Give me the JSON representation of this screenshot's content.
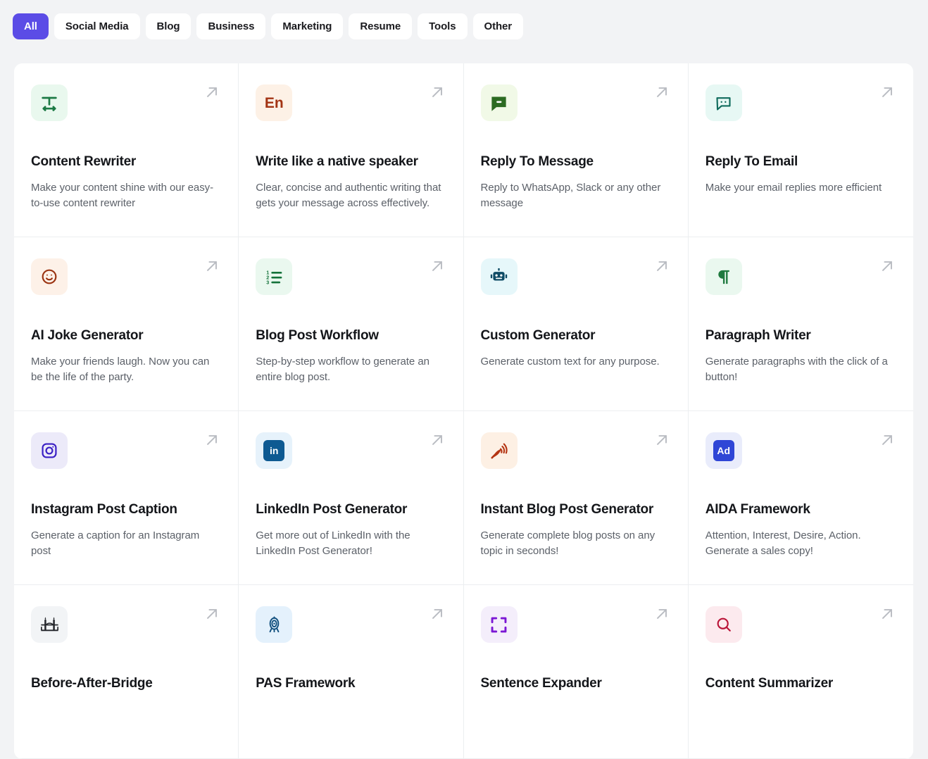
{
  "tabs": [
    {
      "label": "All",
      "active": true
    },
    {
      "label": "Social Media",
      "active": false
    },
    {
      "label": "Blog",
      "active": false
    },
    {
      "label": "Business",
      "active": false
    },
    {
      "label": "Marketing",
      "active": false
    },
    {
      "label": "Resume",
      "active": false
    },
    {
      "label": "Tools",
      "active": false
    },
    {
      "label": "Other",
      "active": false
    }
  ],
  "colors": {
    "page_background": "#f2f3f5",
    "active_tab_background": "#5b4ce6",
    "active_tab_text": "#ffffff",
    "tab_background": "#ffffff",
    "tab_text": "#1a1a1e",
    "card_background": "#ffffff",
    "card_divider": "#eceef0",
    "title_text": "#14161a",
    "description_text": "#5c6169",
    "arrow_icon": "#b9bcc2"
  },
  "cards": [
    {
      "title": "Content Rewriter",
      "description": "Make your content shine with our easy-to-use content rewriter",
      "icon": "text-resize-icon",
      "icon_color": "#1d7a45",
      "icon_background": "#e9f8ee",
      "open_icon": "arrow-up-right-icon"
    },
    {
      "title": "Write like a native speaker",
      "description": "Clear, concise and authentic writing that gets your message across effectively.",
      "icon": "en-language-icon",
      "icon_label": "En",
      "icon_color": "#a33414",
      "icon_background": "#fdf1e6",
      "open_icon": "arrow-up-right-icon"
    },
    {
      "title": "Reply To Message",
      "description": "Reply to WhatsApp, Slack or any other message",
      "icon": "chat-bubble-filled-icon",
      "icon_color": "#2c6b22",
      "icon_background": "#f1f9e7",
      "open_icon": "arrow-up-right-icon"
    },
    {
      "title": "Reply To Email",
      "description": "Make your email replies more efficient",
      "icon": "chat-bubble-dots-icon",
      "icon_color": "#0f6b5c",
      "icon_background": "#e7f8f4",
      "open_icon": "arrow-up-right-icon"
    },
    {
      "title": "AI Joke Generator",
      "description": "Make your friends laugh. Now you can be the life of the party.",
      "icon": "smiley-face-icon",
      "icon_color": "#9b3412",
      "icon_background": "#fdf1e8",
      "open_icon": "arrow-up-right-icon"
    },
    {
      "title": "Blog Post Workflow",
      "description": "Step-by-step workflow to generate an entire blog post.",
      "icon": "numbered-list-icon",
      "icon_color": "#14723a",
      "icon_background": "#eaf8ef",
      "open_icon": "arrow-up-right-icon"
    },
    {
      "title": "Custom Generator",
      "description": "Generate custom text for any purpose.",
      "icon": "robot-icon",
      "icon_color": "#0f4c66",
      "icon_background": "#e6f7fa",
      "open_icon": "arrow-up-right-icon"
    },
    {
      "title": "Paragraph Writer",
      "description": "Generate paragraphs with the click of a button!",
      "icon": "pilcrow-icon",
      "icon_color": "#1f7a3f",
      "icon_background": "#eaf8ef",
      "open_icon": "arrow-up-right-icon"
    },
    {
      "title": "Instagram Post Caption",
      "description": "Generate a caption for an Instagram post",
      "icon": "instagram-icon",
      "icon_color": "#3a1fc4",
      "icon_background": "#eceaf9",
      "open_icon": "arrow-up-right-icon"
    },
    {
      "title": "LinkedIn Post Generator",
      "description": "Get more out of LinkedIn with the LinkedIn Post Generator!",
      "icon": "linkedin-icon",
      "icon_label": "in",
      "icon_color": "#0e5a92",
      "icon_background": "#e6f2fb",
      "open_icon": "arrow-up-right-icon"
    },
    {
      "title": "Instant Blog Post Generator",
      "description": "Generate complete blog posts on any topic in seconds!",
      "icon": "quill-signal-icon",
      "icon_color": "#b43412",
      "icon_background": "#fdf0e4",
      "open_icon": "arrow-up-right-icon"
    },
    {
      "title": "AIDA Framework",
      "description": "Attention, Interest, Desire, Action. Generate a sales copy!",
      "icon": "ad-badge-icon",
      "icon_label": "Ad",
      "icon_color": "#2f46d6",
      "icon_background": "#e9ecfb",
      "open_icon": "arrow-up-right-icon"
    },
    {
      "title": "Before-After-Bridge",
      "description": "",
      "icon": "bridge-icon",
      "icon_color": "#24262b",
      "icon_background": "#f2f4f6",
      "open_icon": "arrow-up-right-icon"
    },
    {
      "title": "PAS Framework",
      "description": "",
      "icon": "target-icon",
      "icon_color": "#11507f",
      "icon_background": "#e4f1fc",
      "open_icon": "arrow-up-right-icon"
    },
    {
      "title": "Sentence Expander",
      "description": "",
      "icon": "expand-corners-icon",
      "icon_color": "#7b17d4",
      "icon_background": "#f4eefb",
      "open_icon": "arrow-up-right-icon"
    },
    {
      "title": "Content Summarizer",
      "description": "",
      "icon": "magnifier-icon",
      "icon_color": "#ba1438",
      "icon_background": "#fceaee",
      "open_icon": "arrow-up-right-icon"
    }
  ]
}
